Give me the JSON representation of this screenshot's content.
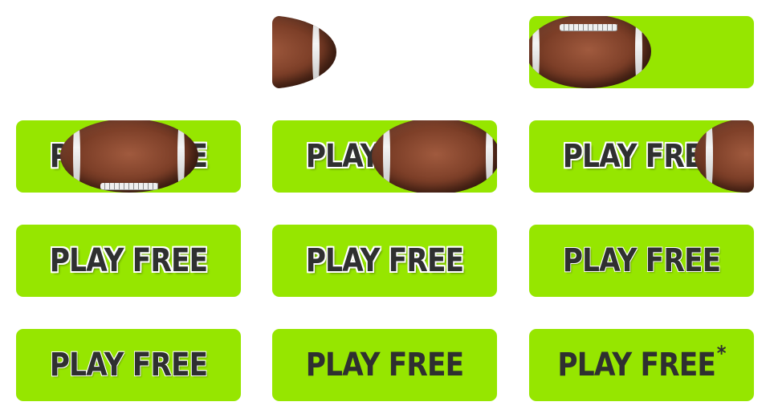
{
  "theme": {
    "accent": "#96e600",
    "text": "#2f3030"
  },
  "buttons": {
    "label": "PLAY FREE",
    "asterisk": "*"
  },
  "icons": [
    "football-icon"
  ]
}
